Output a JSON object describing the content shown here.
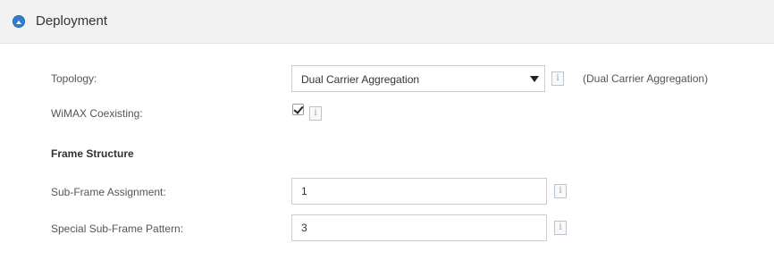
{
  "section": {
    "title": "Deployment",
    "icon": "collapse-icon"
  },
  "topology": {
    "label": "Topology:",
    "selected": "Dual Carrier Aggregation",
    "hint": "(Dual Carrier Aggregation)",
    "info_glyph": "i"
  },
  "wimax": {
    "label": "WiMAX Coexisting:",
    "checked": true,
    "info_glyph": "i"
  },
  "frame_structure": {
    "heading": "Frame Structure"
  },
  "subframe_assignment": {
    "label": "Sub-Frame Assignment:",
    "value": "1",
    "info_glyph": "i"
  },
  "special_subframe_pattern": {
    "label": "Special Sub-Frame Pattern:",
    "value": "3",
    "info_glyph": "i"
  },
  "colors": {
    "accent": "#2f7fd1",
    "header_bg": "#f2f2f2",
    "border": "#cccccc"
  }
}
